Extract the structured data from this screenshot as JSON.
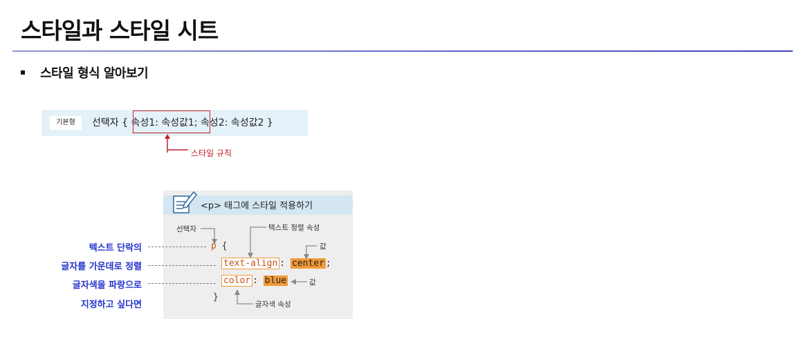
{
  "page": {
    "title": "스타일과 스타일 시트",
    "section_heading": "스타일 형식 알아보기"
  },
  "syntax": {
    "tag": "기본형",
    "code": "선택자 { 속성1: 속성값1; 속성2: 속성값2 }",
    "rule_label": "스타일 규칙"
  },
  "example": {
    "header": "<p> 태그에 스타일 적용하기",
    "selector_note": "선택자",
    "text_align_note": "텍스트 정렬 속성",
    "value_note_top": "값",
    "value_note_bottom": "값",
    "color_note": "글자색 속성",
    "code": {
      "selector": "p",
      "open_brace": "{",
      "close_brace": "}",
      "prop1": "text-align",
      "colon": ":",
      "val1": "center",
      "semicolon": ";",
      "prop2": "color",
      "val2": "blue"
    }
  },
  "explanations": [
    "텍스트 단락의",
    "글자를 가운데로 정렬",
    "글자색을 파랑으로",
    "지정하고 싶다면"
  ],
  "colors": {
    "accent_red": "#c0202a",
    "accent_orange": "#f29a38",
    "label_blue": "#2233cc",
    "syntax_bg": "#e4f1f8",
    "header_bg": "#d4e6f2"
  }
}
